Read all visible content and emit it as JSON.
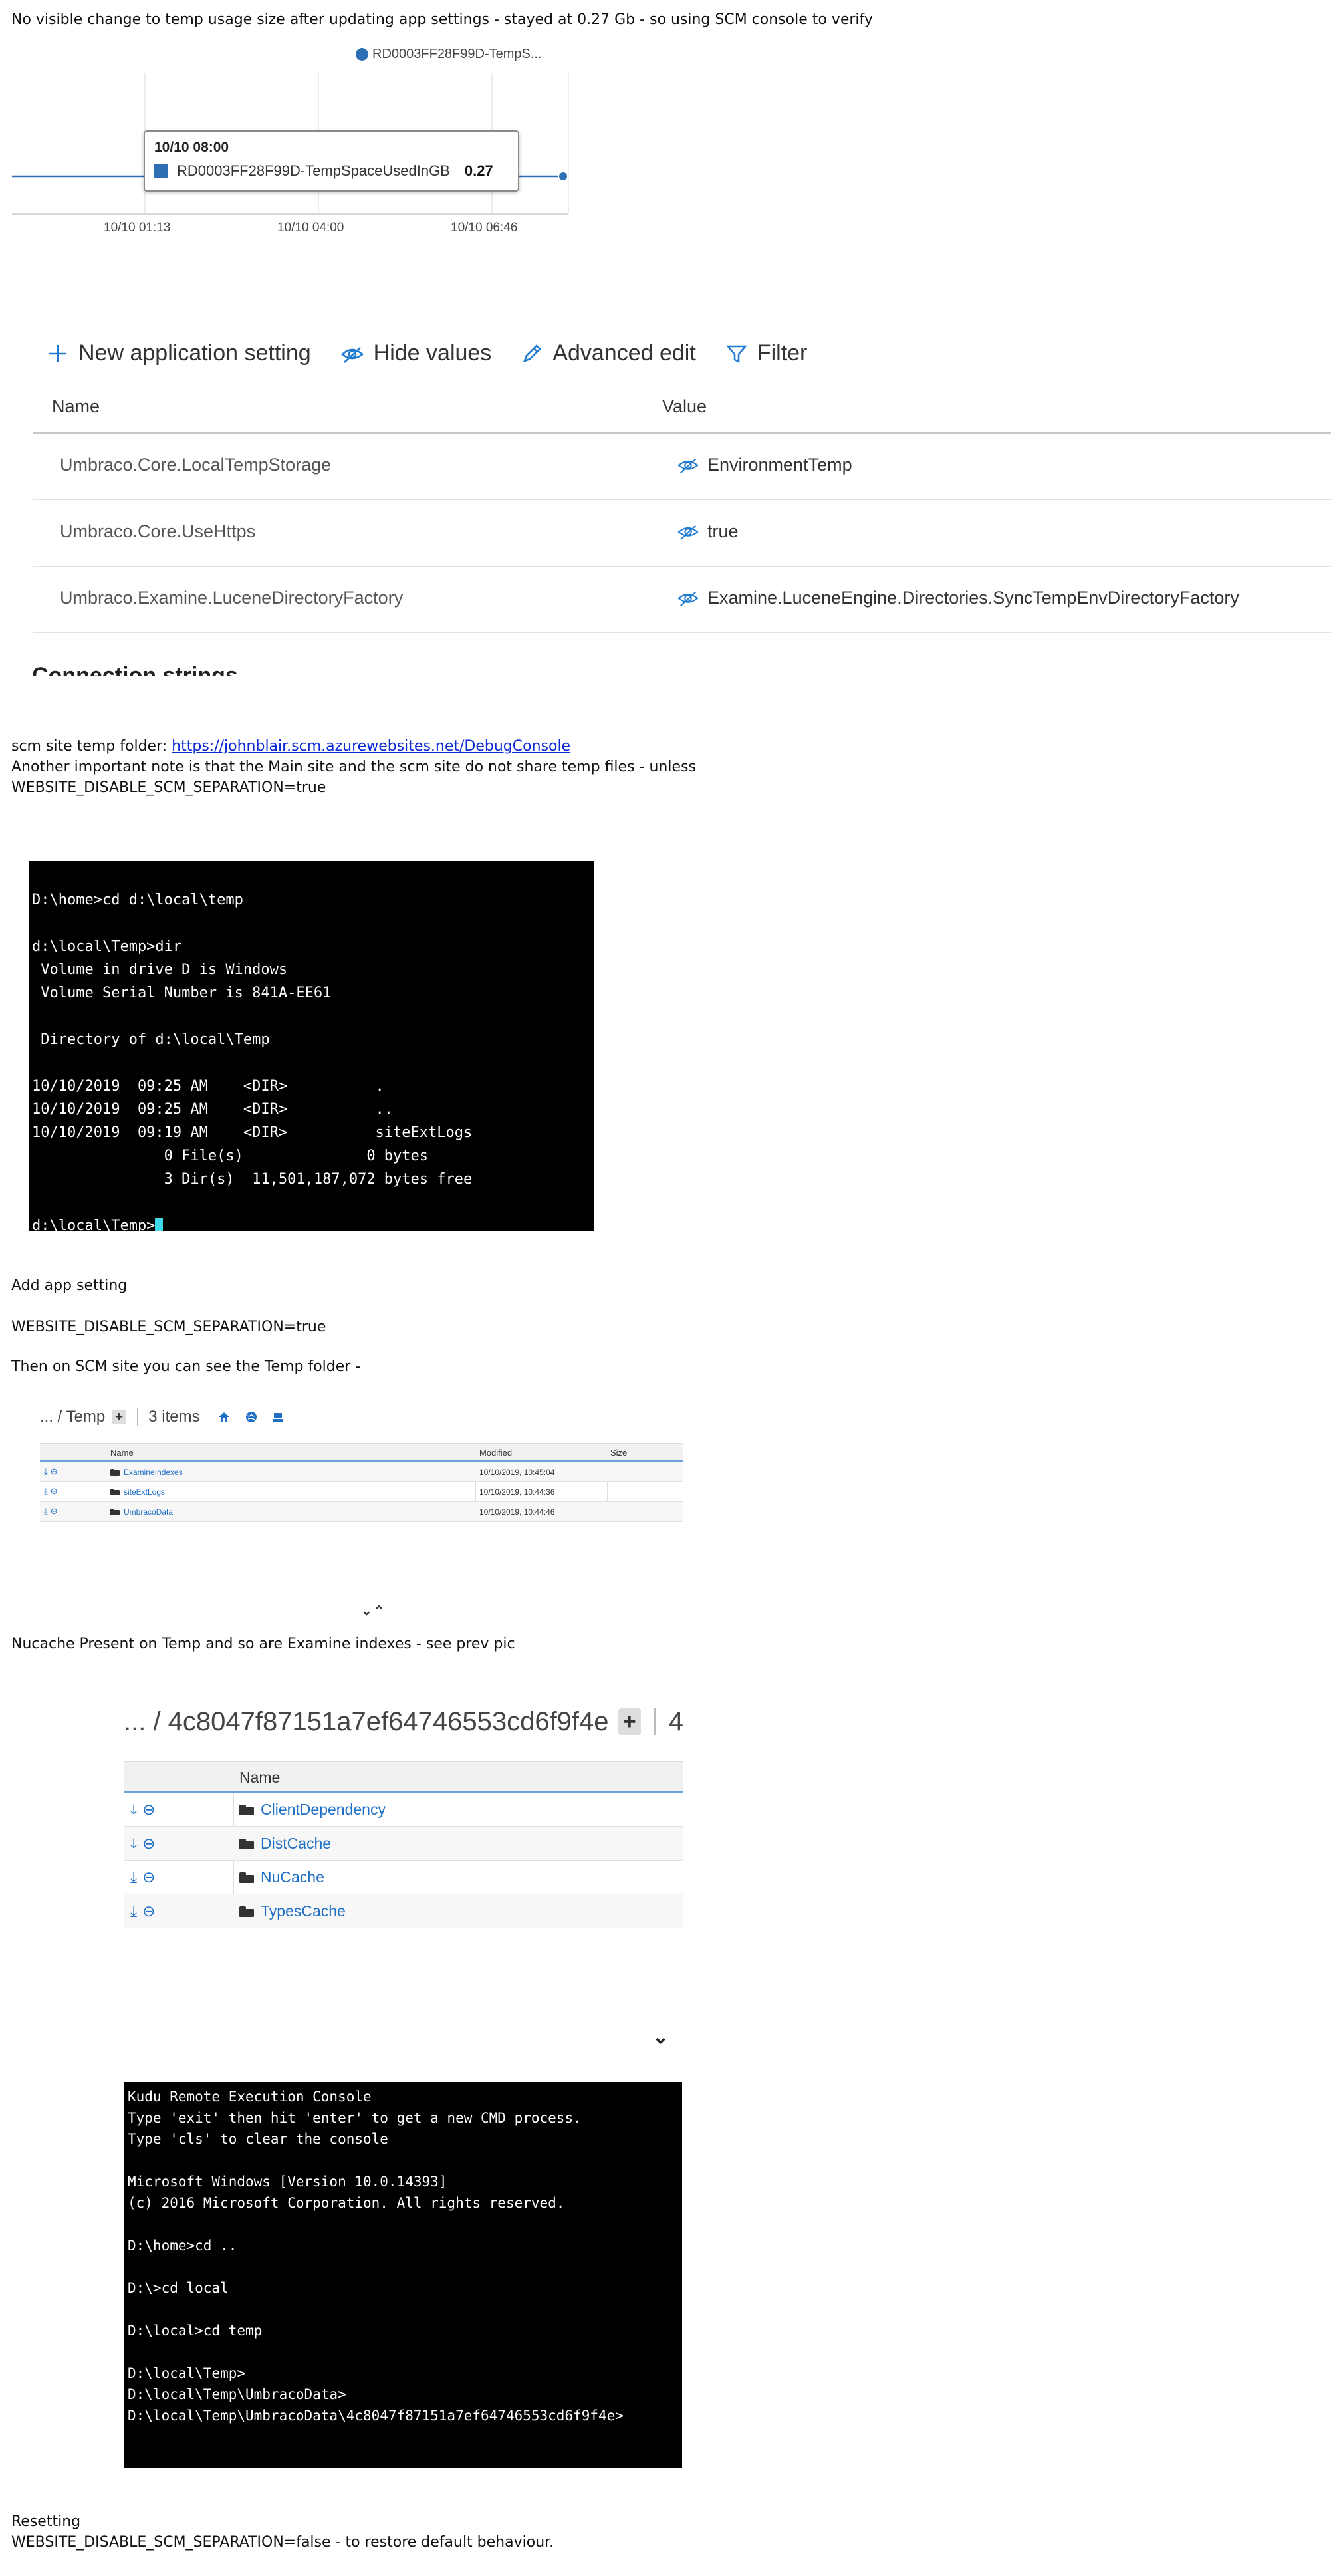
{
  "notes": {
    "top": "No visible change to temp usage size after updating app settings - stayed at 0.27 Gb - so using SCM console to verify",
    "scm_prefix": "scm site temp folder:",
    "scm_link": "https://johnblair.scm.azurewebsites.net/DebugConsole",
    "share_note": "Another important note is that the Main site and the scm site do not share temp files - unless",
    "separation_true_1": "WEBSITE_DISABLE_SCM_SEPARATION=true",
    "add_app_setting": "Add app setting",
    "separation_true_2": "WEBSITE_DISABLE_SCM_SEPARATION=true",
    "then_scm": "Then on SCM site you can see the Temp folder -",
    "nucache": "Nucache Present on Temp and so are Examine indexes - see prev pic",
    "resetting": "Resetting",
    "separation_false": "WEBSITE_DISABLE_SCM_SEPARATION=false - to restore default behaviour."
  },
  "chart_data": {
    "type": "line",
    "legend": "RD0003FF28F99D-TempS...",
    "x_ticks": [
      "10/10 01:13",
      "10/10 04:00",
      "10/10 06:46"
    ],
    "series": [
      {
        "name": "RD0003FF28F99D-TempSpaceUsedInGB",
        "values": [
          0.27,
          0.27,
          0.27,
          0.27
        ],
        "color": "#2d6eb4"
      }
    ],
    "tooltip": {
      "time": "10/10 08:00",
      "series": "RD0003FF28F99D-TempSpaceUsedInGB",
      "value": "0.27"
    }
  },
  "app_settings": {
    "toolbar": {
      "new": "New application setting",
      "hide": "Hide values",
      "advanced": "Advanced edit",
      "filter": "Filter"
    },
    "headers": {
      "name": "Name",
      "value": "Value"
    },
    "rows": [
      {
        "name": "Umbraco.Core.LocalTempStorage",
        "value": "EnvironmentTemp"
      },
      {
        "name": "Umbraco.Core.UseHttps",
        "value": "true"
      },
      {
        "name": "Umbraco.Examine.LuceneDirectoryFactory",
        "value": "Examine.LuceneEngine.Directories.SyncTempEnvDirectoryFactory"
      }
    ],
    "next_section": "Connection strings"
  },
  "console1": "\nD:\\home>cd d:\\local\\temp\n\nd:\\local\\Temp>dir\n Volume in drive D is Windows\n Volume Serial Number is 841A-EE61\n\n Directory of d:\\local\\Temp\n\n10/10/2019  09:25 AM    <DIR>          .\n10/10/2019  09:25 AM    <DIR>          ..\n10/10/2019  09:19 AM    <DIR>          siteExtLogs\n               0 File(s)              0 bytes\n               3 Dir(s)  11,501,187,072 bytes free\n\n",
  "console1_prompt": "d:\\local\\Temp>",
  "kudu1": {
    "path": "... / Temp",
    "count": "3 items",
    "headers": {
      "name": "Name",
      "modified": "Modified",
      "size": "Size"
    },
    "rows": [
      {
        "name": "ExamineIndexes",
        "modified": "10/10/2019, 10:45:04"
      },
      {
        "name": "siteExtLogs",
        "modified": "10/10/2019, 10:44:36"
      },
      {
        "name": "UmbracoData",
        "modified": "10/10/2019, 10:44:46"
      }
    ]
  },
  "chevrons": "⌄⌃",
  "kudu2": {
    "path": "... / 4c8047f87151a7ef64746553cd6f9f4e",
    "count": "4",
    "header": "Name",
    "rows": [
      {
        "name": "ClientDependency"
      },
      {
        "name": "DistCache"
      },
      {
        "name": "NuCache"
      },
      {
        "name": "TypesCache"
      }
    ]
  },
  "console2": "Kudu Remote Execution Console\nType 'exit' then hit 'enter' to get a new CMD process.\nType 'cls' to clear the console\n\nMicrosoft Windows [Version 10.0.14393]\n(c) 2016 Microsoft Corporation. All rights reserved.\n\nD:\\home>cd ..\n\nD:\\>cd local\n\nD:\\local>cd temp\n\nD:\\local\\Temp>\nD:\\local\\Temp\\UmbracoData>\nD:\\local\\Temp\\UmbracoData\\4c8047f87151a7ef64746553cd6f9f4e>"
}
